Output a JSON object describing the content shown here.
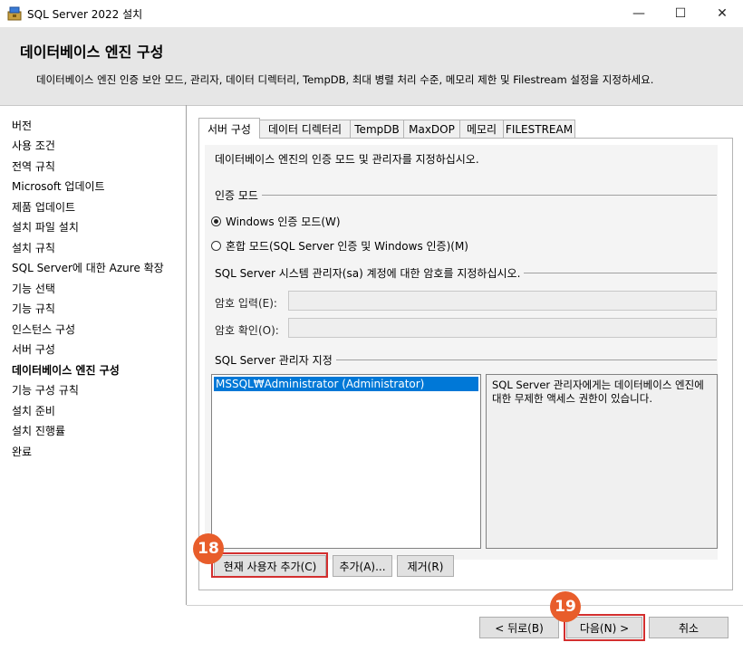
{
  "window": {
    "title": "SQL Server 2022 설치",
    "controls": {
      "minimize": "—",
      "maximize": "☐",
      "close": "✕"
    }
  },
  "header": {
    "heading": "데이터베이스 엔진 구성",
    "description": "데이터베이스 엔진 인증 보안 모드, 관리자, 데이터 디렉터리, TempDB, 최대 병렬 처리 수준, 메모리 제한 및 Filestream 설정을 지정하세요."
  },
  "sidebar": {
    "items": [
      {
        "label": "버전"
      },
      {
        "label": "사용 조건"
      },
      {
        "label": "전역 규칙"
      },
      {
        "label": "Microsoft 업데이트"
      },
      {
        "label": "제품 업데이트"
      },
      {
        "label": "설치 파일 설치"
      },
      {
        "label": "설치 규칙"
      },
      {
        "label": "SQL Server에 대한 Azure 확장"
      },
      {
        "label": "기능 선택"
      },
      {
        "label": "기능 규칙"
      },
      {
        "label": "인스턴스 구성"
      },
      {
        "label": "서버 구성"
      },
      {
        "label": "데이터베이스 엔진 구성",
        "active": true
      },
      {
        "label": "기능 구성 규칙"
      },
      {
        "label": "설치 준비"
      },
      {
        "label": "설치 진행률"
      },
      {
        "label": "완료"
      }
    ]
  },
  "tabs": [
    {
      "label": "서버 구성",
      "active": true
    },
    {
      "label": "데이터 디렉터리"
    },
    {
      "label": "TempDB"
    },
    {
      "label": "MaxDOP"
    },
    {
      "label": "메모리"
    },
    {
      "label": "FILESTREAM"
    }
  ],
  "server_config": {
    "instruction": "데이터베이스 엔진의 인증 모드 및 관리자를 지정하십시오.",
    "auth_group_label": "인증 모드",
    "auth_options": [
      {
        "label": "Windows 인증 모드(W)",
        "selected": true
      },
      {
        "label": "혼합 모드(SQL Server 인증 및 Windows 인증)(M)",
        "selected": false
      }
    ],
    "sa_group_label": "SQL Server 시스템 관리자(sa) 계정에 대한 암호를 지정하십시오.",
    "password_label": "암호 입력(E):",
    "confirm_label": "암호 확인(O):",
    "password_value": "",
    "confirm_value": "",
    "admin_group_label": "SQL Server 관리자 지정",
    "admins": [
      "MSSQL₩Administrator (Administrator)"
    ],
    "admin_note": "SQL Server 관리자에게는 데이터베이스 엔진에 대한 무제한 액세스 권한이 있습니다.",
    "add_current_user_label": "현재 사용자 추가(C)",
    "add_label": "추가(A)...",
    "remove_label": "제거(R)"
  },
  "footer": {
    "back_label": "< 뒤로(B)",
    "next_label": "다음(N) >",
    "cancel_label": "취소"
  },
  "annotations": {
    "step_a": "18",
    "step_b": "19",
    "marker_color": "#e85d2b",
    "highlight_color": "#d32f2f"
  }
}
